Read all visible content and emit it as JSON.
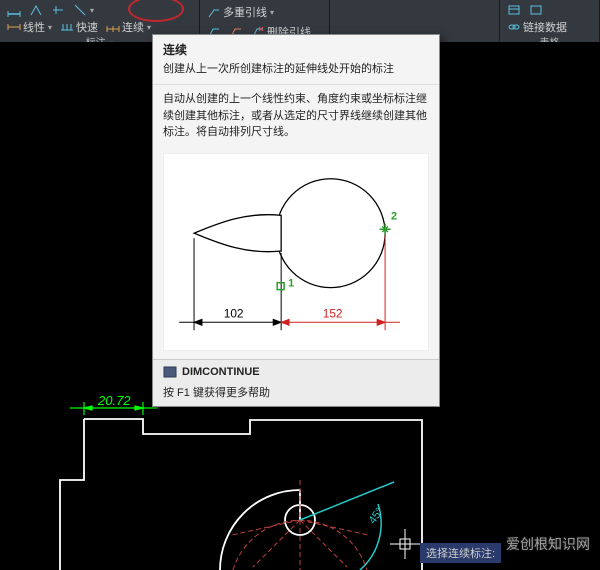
{
  "ribbon": {
    "panel1_title": "标注",
    "panel2_title": "表格",
    "linear": "线性",
    "quick": "快速",
    "continue": "连续",
    "multileader": "多重引线",
    "delete_leader": "删除引线",
    "link_data": "链接数据"
  },
  "tooltip": {
    "title": "连续",
    "short_desc": "创建从上一次所创建标注的延伸线处开始的标注",
    "long_desc": "自动从创建的上一个线性约束、角度约束或坐标标注继续创建其他标注，或者从选定的尺寸界线继续创建其他标注。将自动排列尺寸线。",
    "dim1": "102",
    "dim2": "152",
    "point1": "1",
    "point2": "2",
    "command": "DIMCONTINUE",
    "help": "按 F1 键获得更多帮助"
  },
  "drawing": {
    "dim_value": "20.72",
    "angle_value": "45°",
    "prompt": "选择连续标注:"
  },
  "watermark": "爱创根知识网"
}
